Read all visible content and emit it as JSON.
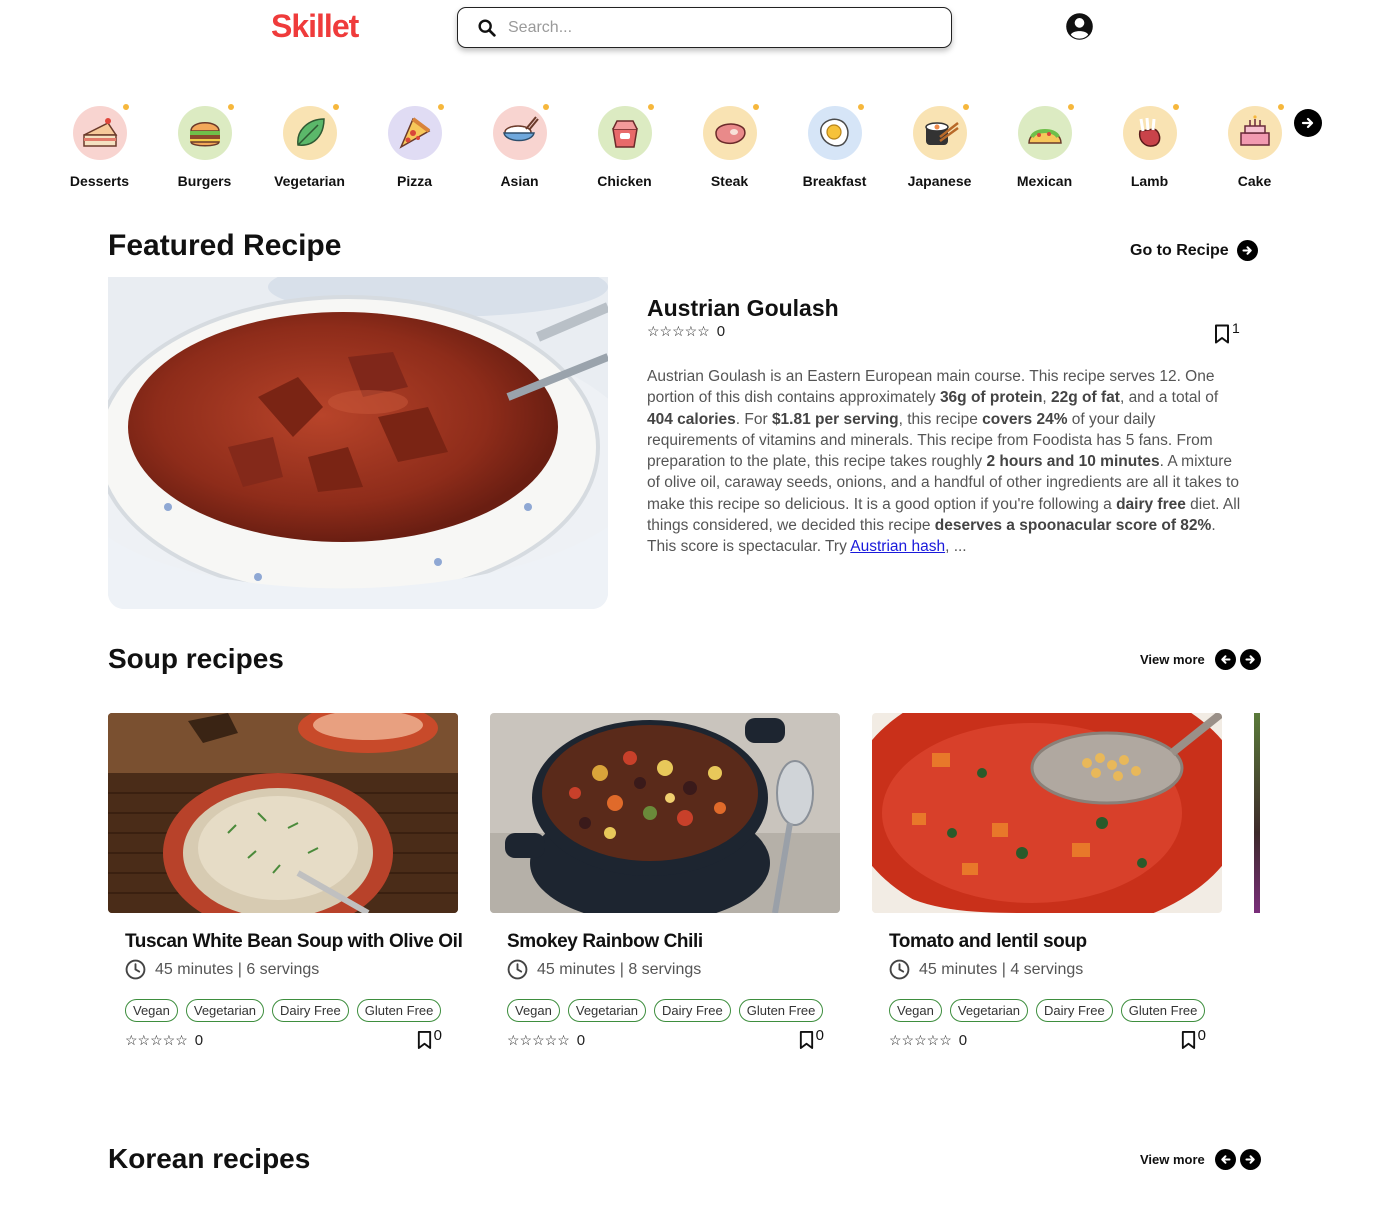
{
  "header": {
    "logo": "Skillet",
    "search_placeholder": "Search..."
  },
  "categories": [
    {
      "label": "Desserts",
      "icon": "cake-slice-icon",
      "bg": "#f8d4d0"
    },
    {
      "label": "Burgers",
      "icon": "burger-icon",
      "bg": "#dcebc2"
    },
    {
      "label": "Vegetarian",
      "icon": "leaf-icon",
      "bg": "#f9e3b3"
    },
    {
      "label": "Pizza",
      "icon": "pizza-icon",
      "bg": "#e0dcf4"
    },
    {
      "label": "Asian",
      "icon": "rice-bowl-icon",
      "bg": "#f8d4d0"
    },
    {
      "label": "Chicken",
      "icon": "takeout-box-icon",
      "bg": "#dcebc2"
    },
    {
      "label": "Steak",
      "icon": "steak-icon",
      "bg": "#f9e3b3"
    },
    {
      "label": "Breakfast",
      "icon": "fried-egg-icon",
      "bg": "#d6e5f7"
    },
    {
      "label": "Japanese",
      "icon": "sushi-icon",
      "bg": "#f9e3b3"
    },
    {
      "label": "Mexican",
      "icon": "taco-icon",
      "bg": "#dcebc2"
    },
    {
      "label": "Lamb",
      "icon": "lamb-rack-icon",
      "bg": "#f9e3b3"
    },
    {
      "label": "Cake",
      "icon": "birthday-cake-icon",
      "bg": "#f9e3b3"
    }
  ],
  "featured": {
    "section_title": "Featured Recipe",
    "go_label": "Go to Recipe",
    "title": "Austrian Goulash",
    "rating_count": "0",
    "bookmark_count": "1",
    "summary": {
      "p1": "Austrian Goulash is an Eastern European main course. This recipe serves 12. One portion of this dish contains approximately ",
      "b1": "36g of protein",
      "p2": ", ",
      "b2": "22g of fat",
      "p3": ", and a total of ",
      "b3": "404 calories",
      "p4": ". For ",
      "b4": "$1.81 per serving",
      "p5": ", this recipe ",
      "b5": "covers 24%",
      "p6": " of your daily requirements of vitamins and minerals. This recipe from Foodista has 5 fans. From preparation to the plate, this recipe takes roughly ",
      "b6": "2 hours and 10 minutes",
      "p7": ". A mixture of olive oil, caraway seeds, onions, and a handful of other ingredients are all it takes to make this recipe so delicious. It is a good option if you're following a ",
      "b7": "dairy free",
      "p8": " diet. All things considered, we decided this recipe ",
      "b8": "deserves a spoonacular score of 82%",
      "p9": ". This score is spectacular. Try ",
      "link": "Austrian hash",
      "p10": ", ..."
    }
  },
  "soup": {
    "section_title": "Soup recipes",
    "view_more": "View more",
    "cards": [
      {
        "title": "Tuscan White Bean Soup with Olive Oil",
        "meta": "45 minutes | 6 servings",
        "tags": [
          "Vegan",
          "Vegetarian",
          "Dairy Free",
          "Gluten Free"
        ],
        "rating_count": "0",
        "bookmark_count": "0"
      },
      {
        "title": "Smokey Rainbow Chili",
        "meta": "45 minutes | 8 servings",
        "tags": [
          "Vegan",
          "Vegetarian",
          "Dairy Free",
          "Gluten Free"
        ],
        "rating_count": "0",
        "bookmark_count": "0"
      },
      {
        "title": "Tomato and lentil soup",
        "meta": "45 minutes | 4 servings",
        "tags": [
          "Vegan",
          "Vegetarian",
          "Dairy Free",
          "Gluten Free"
        ],
        "rating_count": "0",
        "bookmark_count": "0"
      }
    ]
  },
  "korean": {
    "section_title": "Korean recipes",
    "view_more": "View more"
  },
  "stars": "☆☆☆☆☆",
  "colors": {
    "brand": "#ef3b3b",
    "tag_border": "#3e8e3e"
  }
}
